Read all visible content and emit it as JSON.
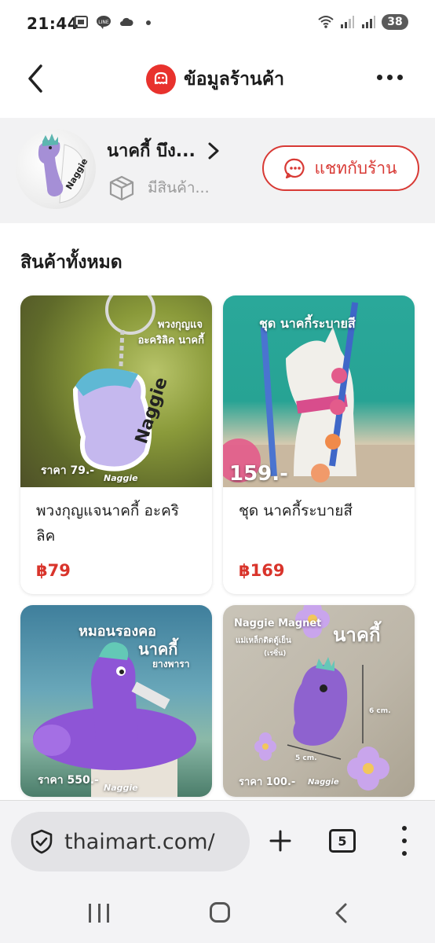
{
  "status_bar": {
    "time": "21:44",
    "battery": "38",
    "icons": [
      "screenshot-icon",
      "line-icon",
      "cloud-icon",
      "wifi-icon",
      "signal-icon",
      "signal-icon"
    ]
  },
  "header": {
    "title": "ข้อมูลร้านค้า",
    "logo_color": "#e8322d"
  },
  "shop": {
    "name": "นาคกี้ บึง...",
    "subtitle": "มีสินค้า...",
    "chat_label": "แชทกับร้าน",
    "accent": "#d83a35"
  },
  "section": {
    "title": "สินค้าทั้งหมด"
  },
  "products": [
    {
      "title": "พวงกุญแจนาคกี้ อะคริลิค",
      "price": "฿79",
      "overlay_top": "พวงกุญแจ",
      "overlay_top2": "อะคริลิค นาคกี้",
      "overlay_price": "ราคา 79.-",
      "overlay_brand": "Naggie"
    },
    {
      "title": "ชุด นาคกี้ระบายสี",
      "price": "฿169",
      "overlay_top": "ชุด นาคกี้ระบายสี",
      "overlay_price": "159.-"
    },
    {
      "title": "",
      "price": "",
      "overlay_top": "หมอนรองคอ",
      "overlay_top2": "นาคกี้",
      "overlay_top3": "ยางพารา",
      "overlay_price": "ราคา 550.-",
      "overlay_brand": "Naggie"
    },
    {
      "title": "",
      "price": "",
      "overlay_top": "Naggie Magnet",
      "overlay_top2": "แม่เหล็กติดตู้เย็น",
      "overlay_top3": "(เรซิ่น)",
      "overlay_name": "นาคกี้",
      "overlay_dim1": "6 cm.",
      "overlay_dim2": "5 cm.",
      "overlay_price": "ราคา 100.-",
      "overlay_brand": "Naggie"
    }
  ],
  "browser": {
    "url": "thaimart.com/",
    "tab_count": "5"
  }
}
